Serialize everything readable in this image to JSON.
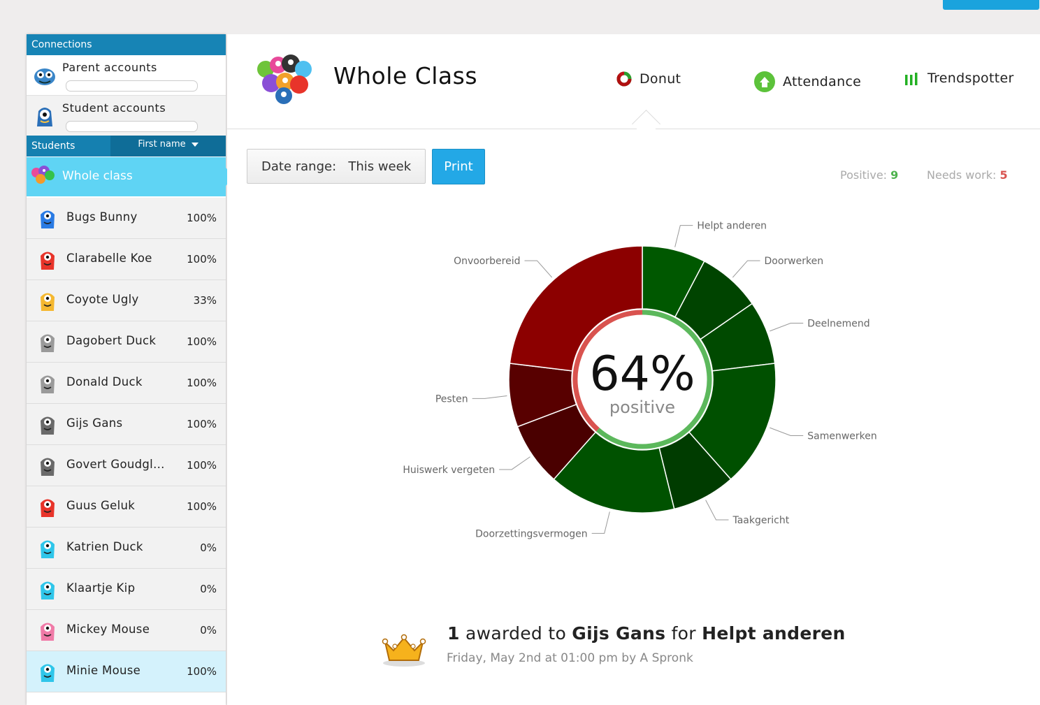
{
  "sidebar": {
    "connections_title": "Connections",
    "parent_accounts": "Parent accounts",
    "student_accounts": "Student accounts",
    "students_title": "Students",
    "sort_label": "First name",
    "whole_class": "Whole class",
    "students": [
      {
        "name": "Bugs Bunny",
        "pct": "100%",
        "color": "#2a7be4"
      },
      {
        "name": "Clarabelle Koe",
        "pct": "100%",
        "color": "#e8342a"
      },
      {
        "name": "Coyote Ugly",
        "pct": "33%",
        "color": "#f5b830"
      },
      {
        "name": "Dagobert Duck",
        "pct": "100%",
        "color": "#9a9a9a"
      },
      {
        "name": "Donald Duck",
        "pct": "100%",
        "color": "#9a9a9a"
      },
      {
        "name": "Gijs Gans",
        "pct": "100%",
        "color": "#6a6a6a"
      },
      {
        "name": "Govert Goudgl...",
        "pct": "100%",
        "color": "#6a6a6a"
      },
      {
        "name": "Guus Geluk",
        "pct": "100%",
        "color": "#e8342a"
      },
      {
        "name": "Katrien Duck",
        "pct": "0%",
        "color": "#2fc6ea"
      },
      {
        "name": "Klaartje Kip",
        "pct": "0%",
        "color": "#2fc6ea"
      },
      {
        "name": "Mickey Mouse",
        "pct": "0%",
        "color": "#f07aa7"
      },
      {
        "name": "Minie Mouse",
        "pct": "100%",
        "color": "#2fc6ea"
      }
    ]
  },
  "header": {
    "title": "Whole Class",
    "tabs": {
      "donut": "Donut",
      "attendance": "Attendance",
      "trendspotter": "Trendspotter"
    }
  },
  "toolbar": {
    "date_label": "Date range:",
    "date_value": "This week",
    "print": "Print"
  },
  "stats": {
    "positive_label": "Positive:",
    "positive_value": "9",
    "needs_label": "Needs work:",
    "needs_value": "5"
  },
  "colors": {
    "positive": "#5cb85c",
    "negative": "#d9534f",
    "accent": "#23a8e6"
  },
  "chart_data": {
    "type": "pie",
    "center_value": "64%",
    "center_label": "positive",
    "categories": [
      "Helpt anderen",
      "Doorwerken",
      "Deelnemend",
      "Samenwerken",
      "Taakgericht",
      "Doorzettingsvermogen",
      "Huiswerk vergeten",
      "Pesten",
      "Onvoorbereid"
    ],
    "values": [
      1,
      1,
      1,
      2,
      1,
      2,
      1,
      1,
      3
    ],
    "kinds": [
      "positive",
      "positive",
      "positive",
      "positive",
      "positive",
      "positive",
      "negative",
      "negative",
      "negative"
    ],
    "fills": [
      "#005800",
      "#004400",
      "#004a00",
      "#005000",
      "#003c00",
      "#005200",
      "#4a0000",
      "#580000",
      "#8c0000"
    ]
  },
  "award": {
    "count": "1",
    "awarded_to": "awarded to",
    "student": "Gijs Gans",
    "for": "for",
    "behavior": "Helpt anderen",
    "meta": "Friday, May 2nd at 01:00 pm by A Spronk"
  }
}
